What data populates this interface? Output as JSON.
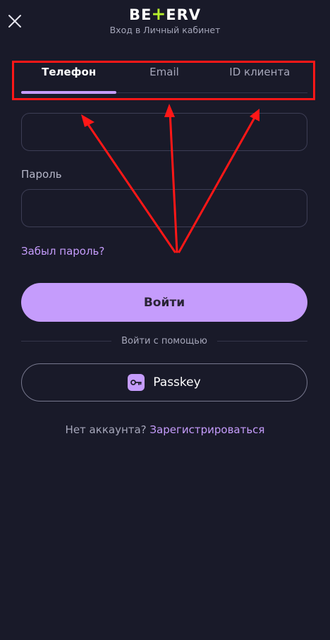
{
  "header": {
    "logo_left": "BE",
    "logo_plus": "+",
    "logo_right": "ERV",
    "subtitle": "Вход в Личный кабинет"
  },
  "tabs": [
    {
      "label": "Телефон",
      "active": true
    },
    {
      "label": "Email",
      "active": false
    },
    {
      "label": "ID клиента",
      "active": false
    }
  ],
  "form": {
    "phone_value": "",
    "password_label": "Пароль",
    "password_value": "",
    "forgot_label": "Забыл пароль?",
    "login_label": "Войти",
    "divider_label": "Войти с помощью",
    "passkey_label": "Passkey"
  },
  "footer": {
    "no_account_label": "Нет аккаунта?",
    "register_label": "Зарегистрироваться"
  },
  "colors": {
    "background": "#191a29",
    "accent": "#c59cfc",
    "annotation": "#ff1717",
    "logo_accent": "#b6ef2d"
  },
  "icons": {
    "close": "close-icon",
    "passkey": "key-icon"
  }
}
